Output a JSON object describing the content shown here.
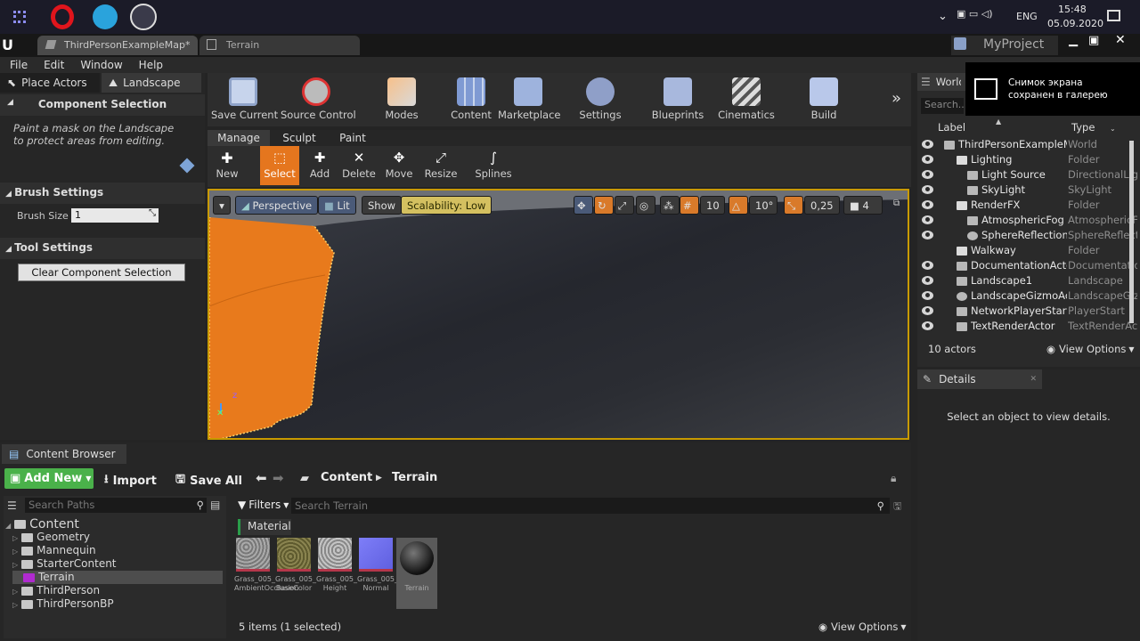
{
  "taskbar": {
    "time": "15:48",
    "date": "05.09.2020",
    "lang": "ENG"
  },
  "tabs": [
    {
      "label": "ThirdPersonExampleMap*"
    },
    {
      "label": "Terrain"
    }
  ],
  "project_name": "MyProject",
  "menu": [
    "File",
    "Edit",
    "Window",
    "Help"
  ],
  "left_panel": {
    "tab_place": "Place Actors",
    "tab_landscape": "Landscape",
    "component_section": "Component Selection",
    "component_desc": "Paint a mask on the Landscape to protect areas from editing.",
    "brush_section": "Brush Settings",
    "brush_size_label": "Brush Size",
    "brush_size_value": "1",
    "tool_section": "Tool Settings",
    "clear_button": "Clear Component Selection"
  },
  "toolbar": [
    "Save Current",
    "Source Control",
    "Modes",
    "Content",
    "Marketplace",
    "Settings",
    "Blueprints",
    "Cinematics",
    "Build"
  ],
  "mode_tabs": [
    "Manage",
    "Sculpt",
    "Paint"
  ],
  "mode_tools": [
    "New",
    "Select",
    "Add",
    "Delete",
    "Move",
    "Resize",
    "Splines"
  ],
  "viewport": {
    "perspective": "Perspective",
    "lit": "Lit",
    "show": "Show",
    "scalability": "Scalability: Low",
    "grid_snap": "10",
    "rot_snap": "10°",
    "scale_snap": "0,25",
    "cam_speed": "4"
  },
  "outliner": {
    "tab": "World",
    "search_placeholder": "Search...",
    "col_label": "Label",
    "col_type": "Type",
    "rows": [
      {
        "label": "ThirdPersonExampleMap",
        "type": "World"
      },
      {
        "label": "Lighting",
        "type": "Folder"
      },
      {
        "label": "Light Source",
        "type": "DirectionalLight"
      },
      {
        "label": "SkyLight",
        "type": "SkyLight"
      },
      {
        "label": "RenderFX",
        "type": "Folder"
      },
      {
        "label": "AtmosphericFog",
        "type": "AtmosphericFog"
      },
      {
        "label": "SphereReflectionCapture",
        "type": "SphereReflectionCapture"
      },
      {
        "label": "Walkway",
        "type": "Folder"
      },
      {
        "label": "DocumentationActor",
        "type": "DocumentationActor"
      },
      {
        "label": "Landscape1",
        "type": "Landscape"
      },
      {
        "label": "LandscapeGizmoActor",
        "type": "LandscapeGizmoActor"
      },
      {
        "label": "NetworkPlayerStart",
        "type": "PlayerStart"
      },
      {
        "label": "TextRenderActor",
        "type": "TextRenderActor"
      }
    ],
    "count": "10 actors",
    "view_options": "View Options"
  },
  "notification": "Снимок экрана сохранен в галерею",
  "details": {
    "tab": "Details",
    "empty_text": "Select an object to view details."
  },
  "content_browser": {
    "tab": "Content Browser",
    "add_new": "Add New",
    "import": "Import",
    "save_all": "Save All",
    "path": [
      "Content",
      "Terrain"
    ],
    "search_paths": "Search Paths",
    "filters": "Filters",
    "search_placeholder": "Search Terrain",
    "tree": [
      "Content",
      "Geometry",
      "Mannequin",
      "StarterContent",
      "Terrain",
      "ThirdPerson",
      "ThirdPersonBP"
    ],
    "filter_tag": "Material",
    "assets": [
      "Grass_005_ AmbientOcclusion",
      "Grass_005_ BaseColor",
      "Grass_005_ Height",
      "Grass_005_ Normal",
      "Terrain"
    ],
    "status": "5 items (1 selected)",
    "view_options": "View Options"
  }
}
